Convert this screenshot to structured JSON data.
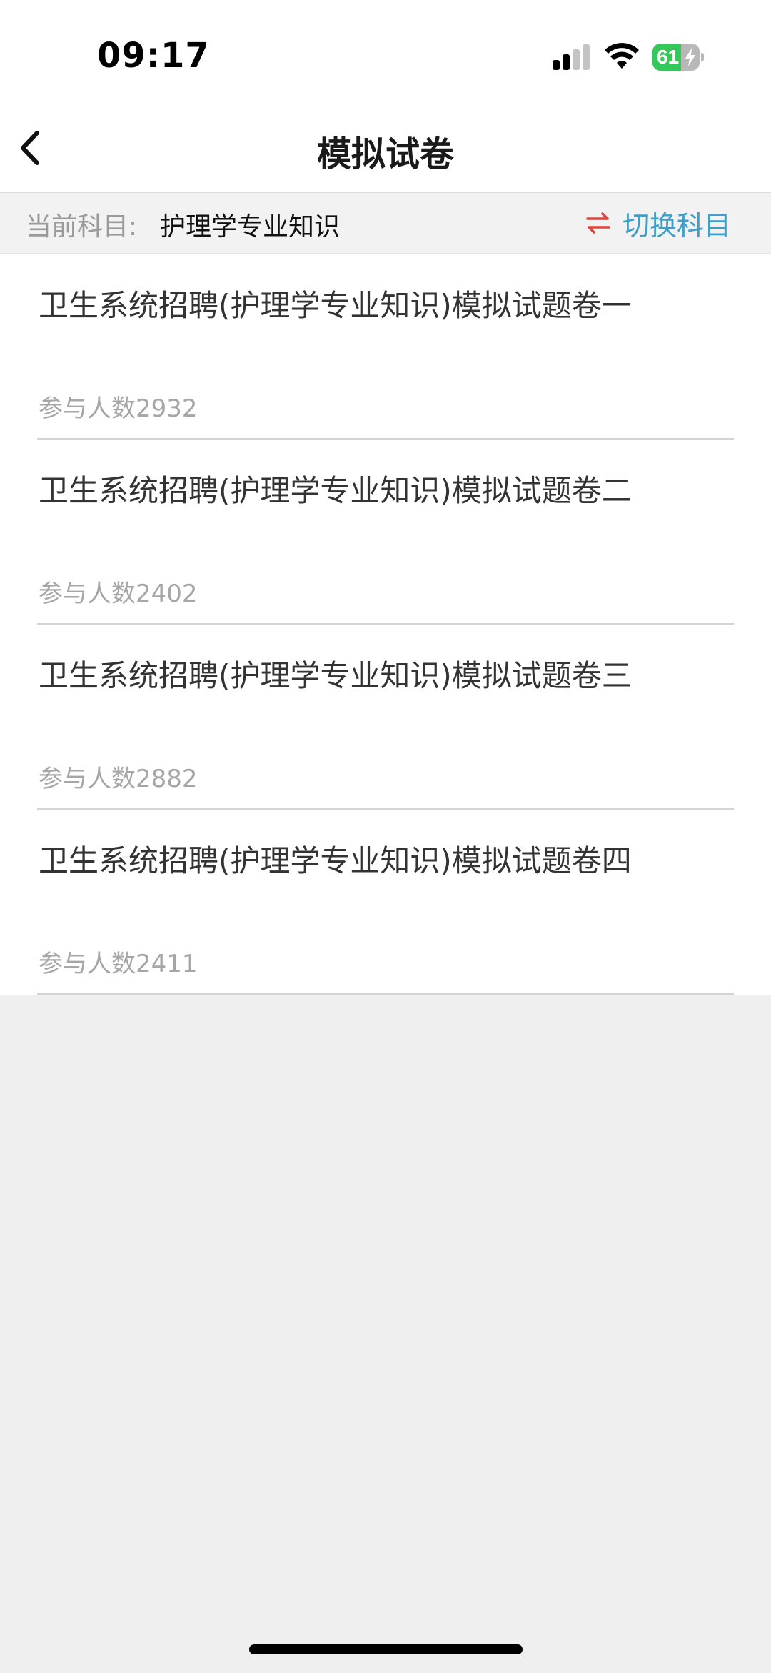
{
  "status_bar": {
    "time": "09:17",
    "battery_level": 61,
    "battery_label": "61"
  },
  "nav": {
    "title": "模拟试卷",
    "back_icon": "chevron-left-icon"
  },
  "subject": {
    "label": "当前科目:",
    "value": "护理学专业知识",
    "switch_label": "切换科目",
    "switch_icon": "swap-arrows-icon",
    "switch_icon_color": "#e0453a",
    "switch_label_color": "#3f9fca"
  },
  "papers": [
    {
      "title": "卫生系统招聘(护理学专业知识)模拟试题卷一",
      "count": "参与人数2932"
    },
    {
      "title": "卫生系统招聘(护理学专业知识)模拟试题卷二",
      "count": "参与人数2402"
    },
    {
      "title": "卫生系统招聘(护理学专业知识)模拟试题卷三",
      "count": "参与人数2882"
    },
    {
      "title": "卫生系统招聘(护理学专业知识)模拟试题卷四",
      "count": "参与人数2411"
    }
  ]
}
